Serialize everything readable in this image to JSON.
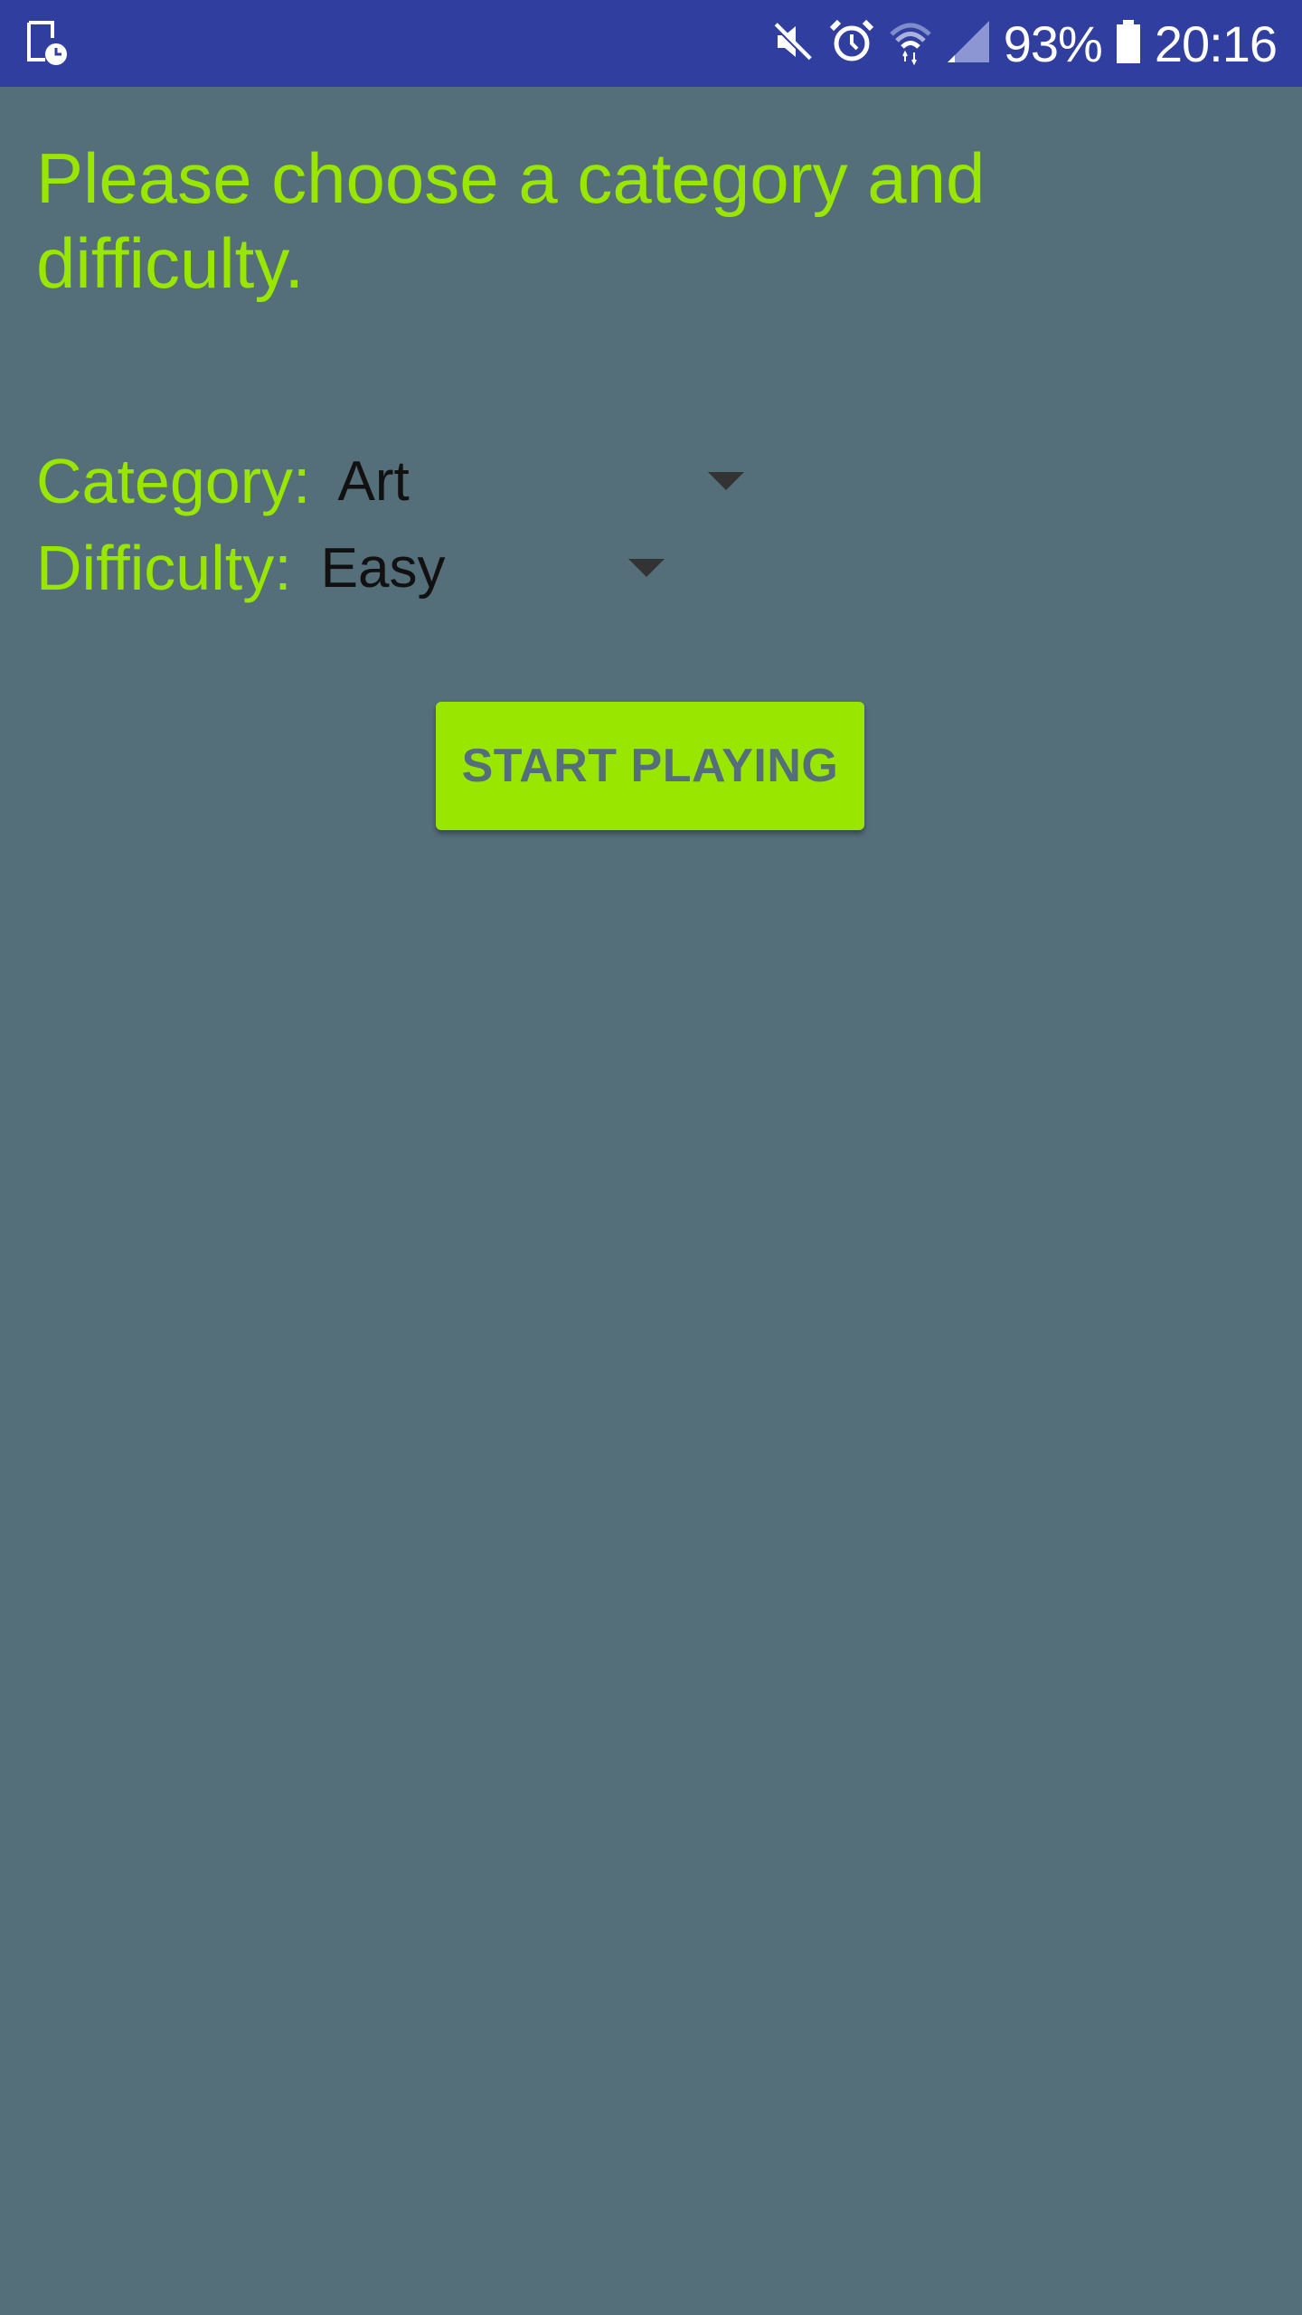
{
  "status_bar": {
    "battery": "93%",
    "time": "20:16",
    "icons": [
      "screenshot-icon",
      "mute-icon",
      "alarm-icon",
      "wifi-icon",
      "signal-icon",
      "battery-icon"
    ],
    "colors": {
      "background": "#303f9f",
      "foreground": "#ffffff"
    }
  },
  "main": {
    "prompt": "Please choose a category and difficulty.",
    "category": {
      "label": "Category:",
      "value": "Art"
    },
    "difficulty": {
      "label": "Difficulty:",
      "value": "Easy"
    },
    "start_button": "START PLAYING",
    "colors": {
      "background": "#546e7a",
      "accent": "#99e600",
      "spinner_text": "#111111"
    }
  }
}
